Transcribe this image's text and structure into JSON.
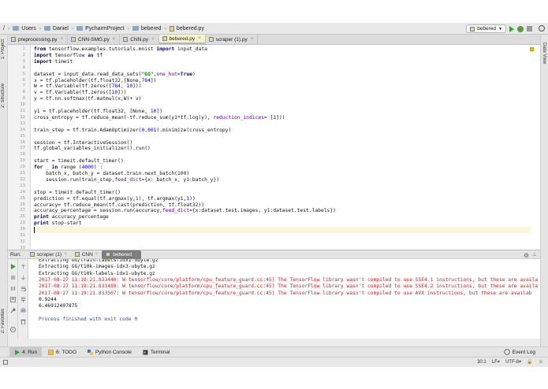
{
  "breadcrumb": [
    "/",
    "Users",
    "Daniel",
    "PycharmProject",
    "bebered",
    "bebered.py"
  ],
  "run_config": "bebered",
  "left_strip": [
    "1: Project",
    "2: Structure",
    "2: Favorites"
  ],
  "right_strip": "Data View",
  "tabs": [
    {
      "label": "preprocessing.py",
      "active": false
    },
    {
      "label": "CNN-SMG.py",
      "active": false
    },
    {
      "label": "CNN.py",
      "active": false
    },
    {
      "label": "bebered.py",
      "active": true
    },
    {
      "label": "scraper (1).py",
      "active": false
    }
  ],
  "code_lines": [
    "from tensorflow.examples.tutorials.mnist import input_data",
    "import tensorflow as tf",
    "import timeit",
    "",
    "dataset = input_data.read_data_sets(\"GG\",one_hot=True)",
    "x = tf.placeholder(tf.float32,[None,784])",
    "W = tf.Variable(tf.zeros([784, 10]))",
    "v = tf.Variable(tf.zeros([10]))",
    "y = tf.nn.softmax(tf.matmul(x,W)+ v)",
    "",
    "y1 = tf.placeholder(tf.float32, [None, 10])",
    "cross_entropy = tf.reduce_mean(-tf.reduce_sum(y1*tf.log(y), reduction_indices= [1]))",
    "",
    "train_step = tf.train.AdamOptimizer(0.001).minimize(cross_entropy)",
    "",
    "session = tf.InteractiveSession()",
    "tf.global_variables_initializer().run()",
    "",
    "start = timeit.default_timer()",
    "for _ in range (4000) :",
    "    batch_x, batch_y = dataset.train.next_batch(100)",
    "    session.run(train_step,feed_dict={x: batch_x, y1:batch_y})",
    "",
    "stop = timeit.default_timer()",
    "prediction = tf.equal(tf.argmax(y,1), tf.argmax(y1,1))",
    "accuracy= tf.reduce_mean(tf.cast(prediction, tf.float32))",
    "accuracy_percentage = session.run(accuracy,feed_dict={x:dataset.test.images, y1:dataset.test.labels})",
    "print accuracy_percentage",
    "print stop-start",
    "",
    "",
    "",
    ""
  ],
  "run_panel": {
    "label": "Run:",
    "tabs": [
      {
        "label": "scraper (1)",
        "active": false
      },
      {
        "label": "CNN",
        "active": false
      },
      {
        "label": "bebered",
        "active": true
      }
    ]
  },
  "console_lines": [
    {
      "text": "Extracting GG/train-labels-idx1-ubyte.gz",
      "kind": "out"
    },
    {
      "text": "Extracting GG/t10k-images-idx3-ubyte.gz",
      "kind": "out"
    },
    {
      "text": "Extracting GG/t10k-labels-idx1-ubyte.gz",
      "kind": "out"
    },
    {
      "text": "2017-08-27 11:19:21.833440: W tensorflow/core/platform/cpu_feature_guard.cc:45] The TensorFlow library wasn't compiled to use SSE4.1 instructions, but these are availa",
      "kind": "err"
    },
    {
      "text": "2017-08-27 11:19:21.833489: W tensorflow/core/platform/cpu_feature_guard.cc:45] The TensorFlow library wasn't compiled to use SSE4.2 instructions, but these are availa",
      "kind": "err"
    },
    {
      "text": "2017-08-27 11:19:21.833507: W tensorflow/core/platform/cpu_feature_guard.cc:45] The TensorFlow library wasn't compiled to use AVX instructions, but these are availab",
      "kind": "err"
    },
    {
      "text": "0.9244",
      "kind": "out"
    },
    {
      "text": "6.46912407875",
      "kind": "out"
    },
    {
      "text": "",
      "kind": "out"
    },
    {
      "text": "Process finished with exit code 0",
      "kind": "fin"
    }
  ],
  "bottom_tools": [
    {
      "label": "4: Run",
      "active": true,
      "icon": "play-icon"
    },
    {
      "label": "6: TODO",
      "active": false,
      "icon": "todo-icon"
    },
    {
      "label": "Python Console",
      "active": false,
      "icon": "python-icon"
    },
    {
      "label": "Terminal",
      "active": false,
      "icon": "terminal-icon"
    }
  ],
  "event_log": "Event Log",
  "status": {
    "position": "30:1",
    "line_sep": "LF≠",
    "encoding": "UTF-8≠"
  }
}
